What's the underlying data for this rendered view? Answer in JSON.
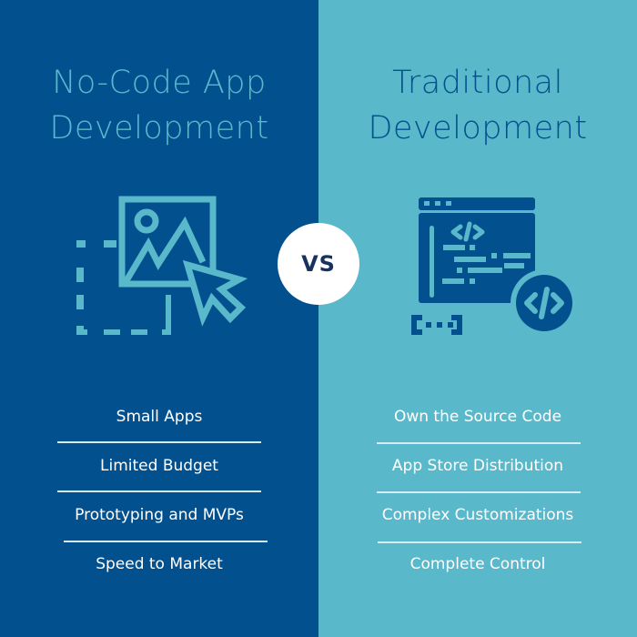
{
  "colors": {
    "left_bg": "#03508f",
    "right_bg": "#5ab8cb",
    "vs_text": "#16335f",
    "list_text": "#ffffff"
  },
  "left": {
    "title_lines": [
      "No-Code App",
      "Development"
    ],
    "icon": "image-select-cursor-icon",
    "items": [
      "Small Apps",
      "Limited Budget",
      "Prototyping and MVPs",
      "Speed to Market"
    ]
  },
  "right": {
    "title_lines": [
      "Traditional",
      "Development"
    ],
    "icon": "code-window-icon",
    "items": [
      "Own the Source Code",
      "App Store Distribution",
      "Complex Customizations",
      "Complete Control"
    ]
  },
  "vs_label": "VS"
}
